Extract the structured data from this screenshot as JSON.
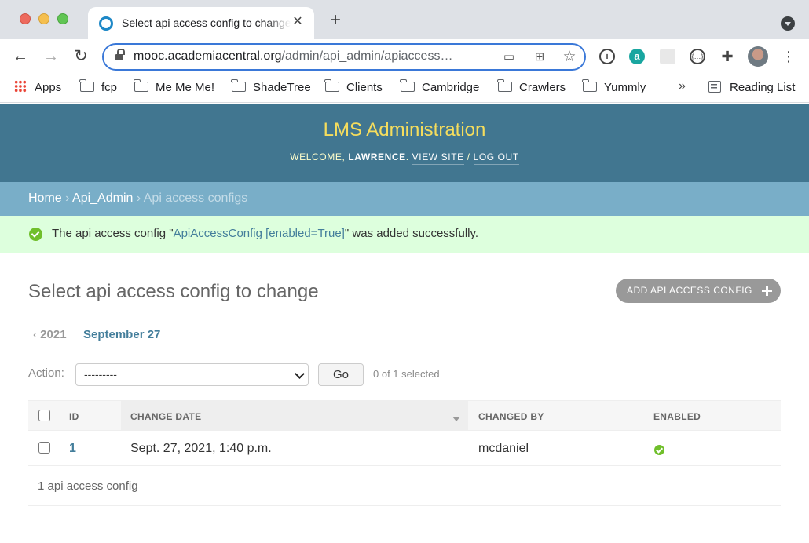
{
  "browser": {
    "tab_title": "Select api access config to change | LMS Administration",
    "tab_close": "✕",
    "new_tab": "+",
    "url_host": "mooc.academiacentral.org",
    "url_path": "/admin/api_admin/apiaccess…",
    "nav": {
      "back": "←",
      "forward": "→",
      "reload": "↻"
    },
    "omnibox_icons": {
      "cast": "▭",
      "grid": "⊞",
      "star": "☆"
    },
    "extensions": {
      "info": "i",
      "a": "a",
      "code": "{…}",
      "puzzle": "✚"
    },
    "menu": "⋮",
    "bookmarks": [
      {
        "label": "Apps",
        "icon": "apps-grid-icon"
      },
      {
        "label": "fcp",
        "icon": "folder-icon"
      },
      {
        "label": "Me Me Me!",
        "icon": "folder-icon"
      },
      {
        "label": "ShadeTree",
        "icon": "folder-icon"
      },
      {
        "label": "Clients",
        "icon": "folder-icon"
      },
      {
        "label": "Cambridge",
        "icon": "folder-icon"
      },
      {
        "label": "Crawlers",
        "icon": "folder-icon"
      },
      {
        "label": "Yummly",
        "icon": "folder-icon"
      }
    ],
    "bookmarks_more": "»",
    "reading_list": "Reading List"
  },
  "admin": {
    "site_name": "LMS Administration",
    "user_tools": {
      "welcome": "Welcome,",
      "username": "Lawrence",
      "period": ".",
      "view_site": "View site",
      "separator": "/",
      "log_out": "Log out"
    },
    "breadcrumbs": {
      "home": "Home",
      "app": "Api_Admin",
      "current": "Api access configs",
      "sep": "›"
    },
    "message": {
      "prefix": "The api access config \"",
      "link": "ApiAccessConfig [enabled=True]",
      "suffix": "\" was added successfully."
    },
    "title": "Select api access config to change",
    "add_button": "ADD API ACCESS CONFIG",
    "date_hierarchy": {
      "back_arrow": "‹",
      "back_year": "2021",
      "current": "September 27"
    },
    "actions": {
      "label": "Action:",
      "selected_option": "---------",
      "go": "Go",
      "counter": "0 of 1 selected"
    },
    "table": {
      "columns": [
        "ID",
        "CHANGE DATE",
        "CHANGED BY",
        "ENABLED"
      ],
      "rows": [
        {
          "id": "1",
          "change_date": "Sept. 27, 2021, 1:40 p.m.",
          "changed_by": "mcdaniel",
          "enabled": true
        }
      ]
    },
    "paginator": "1 api access config"
  },
  "colors": {
    "header_bg": "#417690",
    "site_name": "#f5dd5d",
    "breadcrumbs_bg": "#79aec8",
    "success_bg": "#dddddd",
    "link": "#447e9b",
    "success_icon": "#70bf2b"
  }
}
